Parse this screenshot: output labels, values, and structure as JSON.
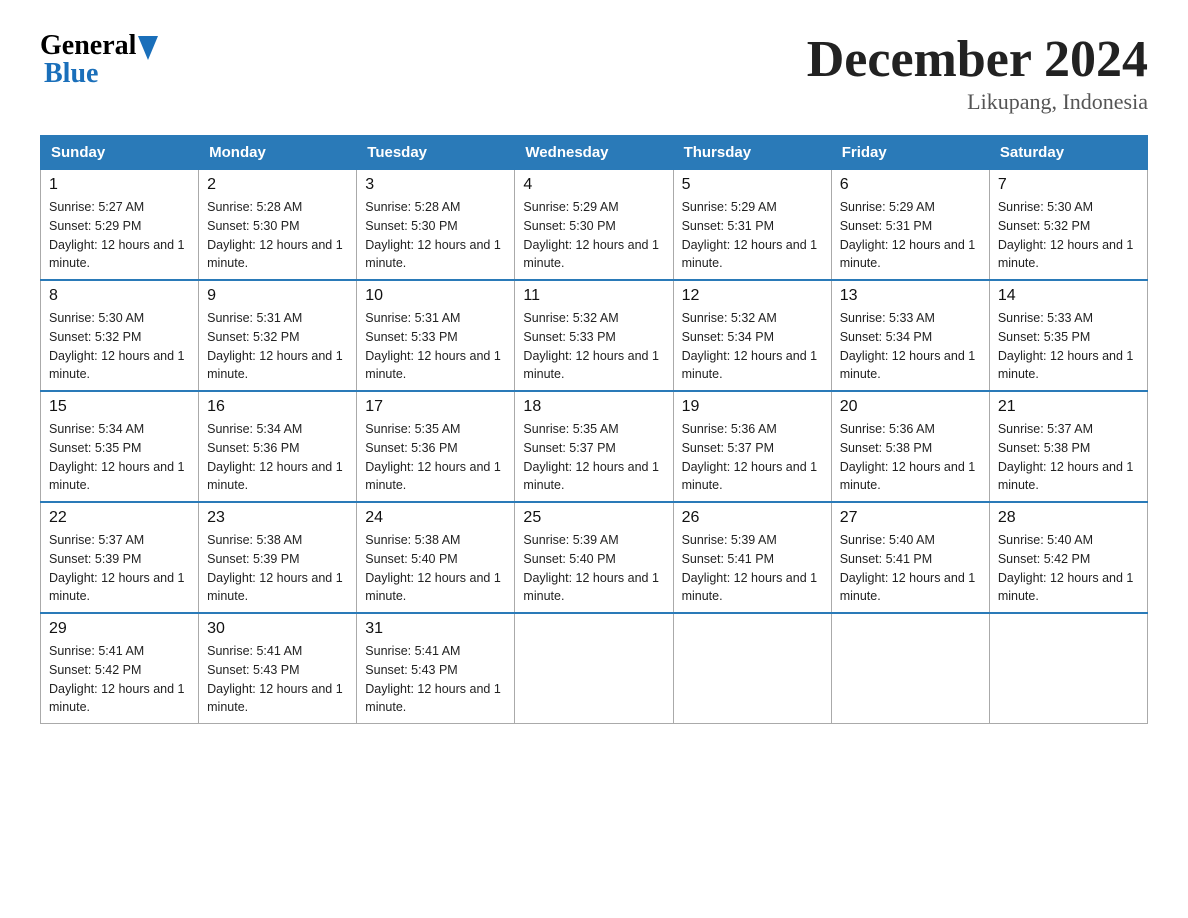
{
  "header": {
    "title": "December 2024",
    "location": "Likupang, Indonesia",
    "logo_general": "General",
    "logo_blue": "Blue"
  },
  "days_of_week": [
    "Sunday",
    "Monday",
    "Tuesday",
    "Wednesday",
    "Thursday",
    "Friday",
    "Saturday"
  ],
  "weeks": [
    [
      {
        "day": "1",
        "sunrise": "5:27 AM",
        "sunset": "5:29 PM",
        "daylight": "12 hours and 1 minute."
      },
      {
        "day": "2",
        "sunrise": "5:28 AM",
        "sunset": "5:30 PM",
        "daylight": "12 hours and 1 minute."
      },
      {
        "day": "3",
        "sunrise": "5:28 AM",
        "sunset": "5:30 PM",
        "daylight": "12 hours and 1 minute."
      },
      {
        "day": "4",
        "sunrise": "5:29 AM",
        "sunset": "5:30 PM",
        "daylight": "12 hours and 1 minute."
      },
      {
        "day": "5",
        "sunrise": "5:29 AM",
        "sunset": "5:31 PM",
        "daylight": "12 hours and 1 minute."
      },
      {
        "day": "6",
        "sunrise": "5:29 AM",
        "sunset": "5:31 PM",
        "daylight": "12 hours and 1 minute."
      },
      {
        "day": "7",
        "sunrise": "5:30 AM",
        "sunset": "5:32 PM",
        "daylight": "12 hours and 1 minute."
      }
    ],
    [
      {
        "day": "8",
        "sunrise": "5:30 AM",
        "sunset": "5:32 PM",
        "daylight": "12 hours and 1 minute."
      },
      {
        "day": "9",
        "sunrise": "5:31 AM",
        "sunset": "5:32 PM",
        "daylight": "12 hours and 1 minute."
      },
      {
        "day": "10",
        "sunrise": "5:31 AM",
        "sunset": "5:33 PM",
        "daylight": "12 hours and 1 minute."
      },
      {
        "day": "11",
        "sunrise": "5:32 AM",
        "sunset": "5:33 PM",
        "daylight": "12 hours and 1 minute."
      },
      {
        "day": "12",
        "sunrise": "5:32 AM",
        "sunset": "5:34 PM",
        "daylight": "12 hours and 1 minute."
      },
      {
        "day": "13",
        "sunrise": "5:33 AM",
        "sunset": "5:34 PM",
        "daylight": "12 hours and 1 minute."
      },
      {
        "day": "14",
        "sunrise": "5:33 AM",
        "sunset": "5:35 PM",
        "daylight": "12 hours and 1 minute."
      }
    ],
    [
      {
        "day": "15",
        "sunrise": "5:34 AM",
        "sunset": "5:35 PM",
        "daylight": "12 hours and 1 minute."
      },
      {
        "day": "16",
        "sunrise": "5:34 AM",
        "sunset": "5:36 PM",
        "daylight": "12 hours and 1 minute."
      },
      {
        "day": "17",
        "sunrise": "5:35 AM",
        "sunset": "5:36 PM",
        "daylight": "12 hours and 1 minute."
      },
      {
        "day": "18",
        "sunrise": "5:35 AM",
        "sunset": "5:37 PM",
        "daylight": "12 hours and 1 minute."
      },
      {
        "day": "19",
        "sunrise": "5:36 AM",
        "sunset": "5:37 PM",
        "daylight": "12 hours and 1 minute."
      },
      {
        "day": "20",
        "sunrise": "5:36 AM",
        "sunset": "5:38 PM",
        "daylight": "12 hours and 1 minute."
      },
      {
        "day": "21",
        "sunrise": "5:37 AM",
        "sunset": "5:38 PM",
        "daylight": "12 hours and 1 minute."
      }
    ],
    [
      {
        "day": "22",
        "sunrise": "5:37 AM",
        "sunset": "5:39 PM",
        "daylight": "12 hours and 1 minute."
      },
      {
        "day": "23",
        "sunrise": "5:38 AM",
        "sunset": "5:39 PM",
        "daylight": "12 hours and 1 minute."
      },
      {
        "day": "24",
        "sunrise": "5:38 AM",
        "sunset": "5:40 PM",
        "daylight": "12 hours and 1 minute."
      },
      {
        "day": "25",
        "sunrise": "5:39 AM",
        "sunset": "5:40 PM",
        "daylight": "12 hours and 1 minute."
      },
      {
        "day": "26",
        "sunrise": "5:39 AM",
        "sunset": "5:41 PM",
        "daylight": "12 hours and 1 minute."
      },
      {
        "day": "27",
        "sunrise": "5:40 AM",
        "sunset": "5:41 PM",
        "daylight": "12 hours and 1 minute."
      },
      {
        "day": "28",
        "sunrise": "5:40 AM",
        "sunset": "5:42 PM",
        "daylight": "12 hours and 1 minute."
      }
    ],
    [
      {
        "day": "29",
        "sunrise": "5:41 AM",
        "sunset": "5:42 PM",
        "daylight": "12 hours and 1 minute."
      },
      {
        "day": "30",
        "sunrise": "5:41 AM",
        "sunset": "5:43 PM",
        "daylight": "12 hours and 1 minute."
      },
      {
        "day": "31",
        "sunrise": "5:41 AM",
        "sunset": "5:43 PM",
        "daylight": "12 hours and 1 minute."
      },
      null,
      null,
      null,
      null
    ]
  ]
}
